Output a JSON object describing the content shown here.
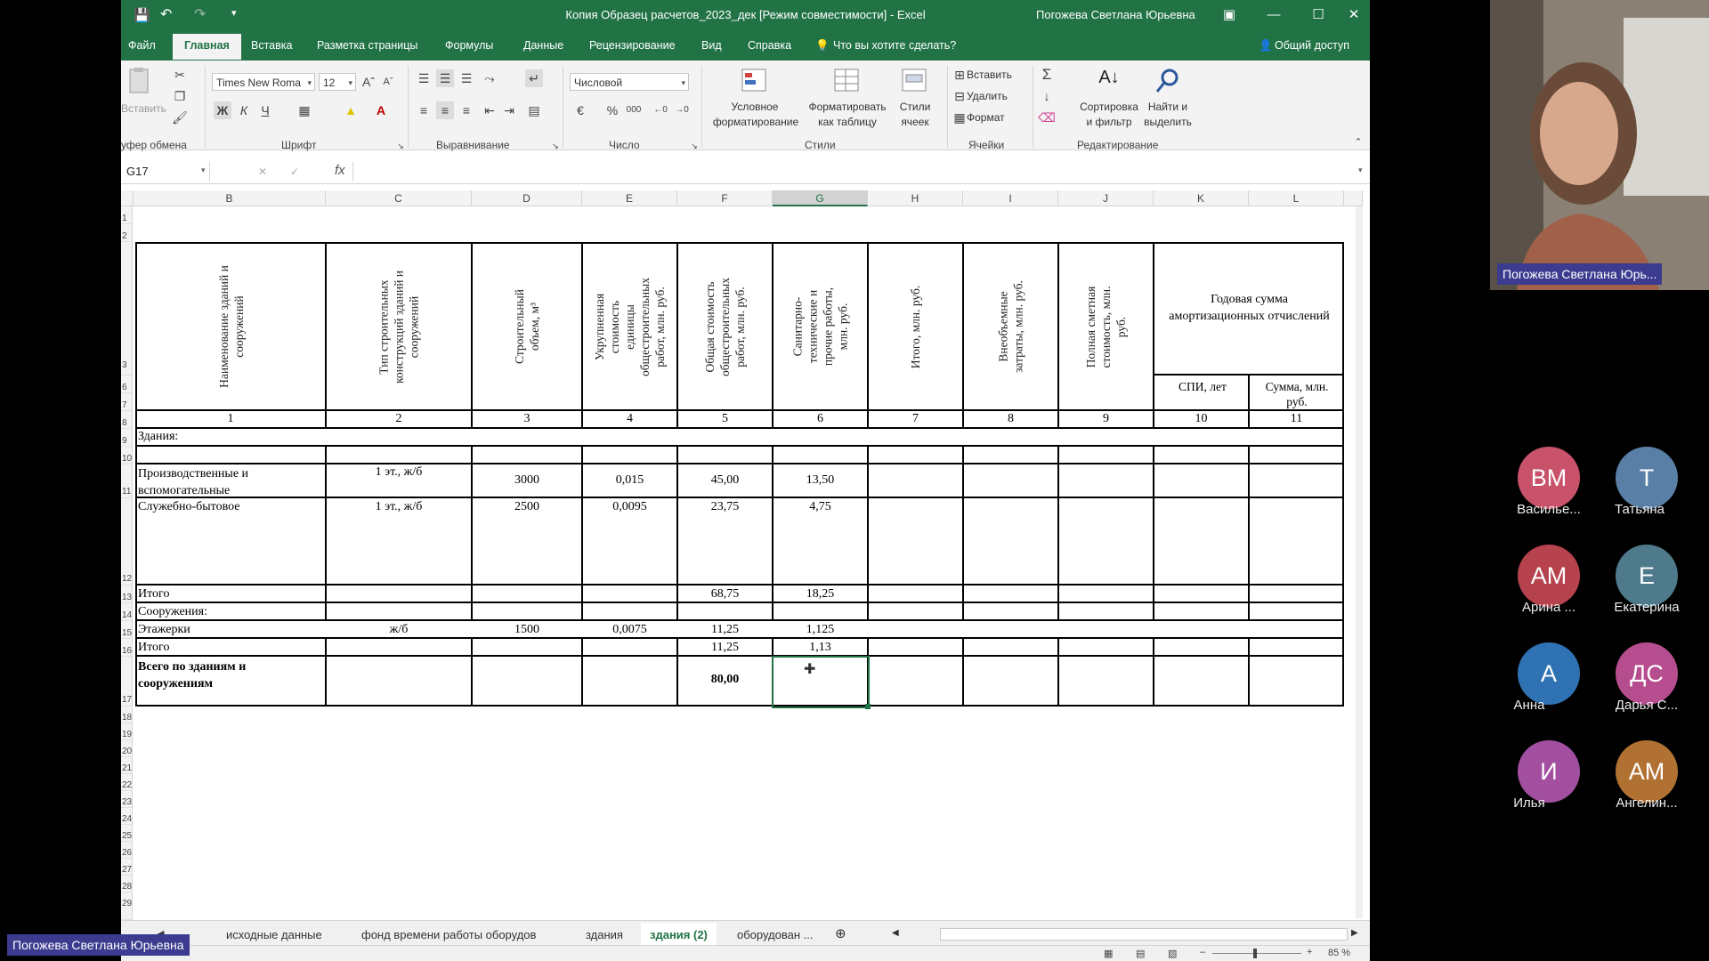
{
  "window": {
    "title": "Копия Образец расчетов_2023_дек  [Режим совместимости]  -  Excel",
    "user": "Погожева Светлана Юрьевна"
  },
  "ribbon_tabs": [
    "Файл",
    "Главная",
    "Вставка",
    "Разметка страницы",
    "Формулы",
    "Данные",
    "Рецензирование",
    "Вид",
    "Справка"
  ],
  "tell_me": "Что вы хотите сделать?",
  "share": "Общий доступ",
  "ribbon": {
    "paste": "Вставить",
    "font_name": "Times New Roma",
    "font_size": "12",
    "bold": "Ж",
    "italic": "К",
    "underline": "Ч",
    "number_format": "Числовой",
    "cond_format": [
      "Условное",
      "форматирование"
    ],
    "format_table": [
      "Форматировать",
      "как таблицу"
    ],
    "cell_styles": [
      "Стили",
      "ячеек"
    ],
    "insert": "Вставить",
    "delete": "Удалить",
    "format": "Формат",
    "sort": [
      "Сортировка",
      "и фильтр"
    ],
    "find": [
      "Найти и",
      "выделить"
    ],
    "groups": {
      "clipboard": "уфер обмена",
      "font": "Шрифт",
      "alignment": "Выравнивание",
      "number": "Число",
      "styles": "Стили",
      "cells": "Ячейки",
      "editing": "Редактирование"
    }
  },
  "namebox": "G17",
  "columns": [
    "B",
    "C",
    "D",
    "E",
    "F",
    "G",
    "H",
    "I",
    "J",
    "K",
    "L"
  ],
  "selected_column": "G",
  "rows": [
    "1",
    "2",
    "3",
    "6",
    "7",
    "8",
    "9",
    "10",
    "11",
    "12",
    "13",
    "14",
    "15",
    "16",
    "17",
    "18",
    "19",
    "20",
    "21",
    "22",
    "23",
    "24",
    "25",
    "26",
    "27",
    "28",
    "29"
  ],
  "table": {
    "headers": [
      "Наименование зданий и сооружений",
      "Тип строительных конструкций зданий и сооружений",
      "Строительный объем, м³",
      "Укрупненная стоимость единицы общестроительных работ, млн. руб.",
      "Общая стоимость общестроительных работ, млн. руб.",
      "Санитарно-технические и прочие работы, млн. руб.",
      "Итого, млн. руб.",
      "Внеобъемные затраты, млн. руб.",
      "Полная сметная стоимость, млн. руб."
    ],
    "amort_header": "Годовая сумма амортизационных отчислений",
    "amort_sub1": "СПИ, лет",
    "amort_sub2": "Сумма, млн. руб.",
    "col_numbers": [
      "1",
      "2",
      "3",
      "4",
      "5",
      "6",
      "7",
      "8",
      "9",
      "10",
      "11"
    ],
    "section_buildings": "Здания:",
    "row11": {
      "name": "Производственные и вспомогательные",
      "type": "1 эт., ж/б",
      "volume": "3000",
      "unit": "0,015",
      "total": "45,00",
      "san": "13,50"
    },
    "row12": {
      "name": "Служебно-бытовое",
      "type": "1 эт., ж/б",
      "volume": "2500",
      "unit": "0,0095",
      "total": "23,75",
      "san": "4,75"
    },
    "row13": {
      "name": "Итого",
      "total": "68,75",
      "san": "18,25"
    },
    "section_structures": "Сооружения:",
    "row15": {
      "name": "Этажерки",
      "type": "ж/б",
      "volume": "1500",
      "unit": "0,0075",
      "total": "11,25",
      "san": "1,125"
    },
    "row16": {
      "name": "Итого",
      "total": "11,25",
      "san": "1,13"
    },
    "row17": {
      "name": "Всего по зданиям и сооружениям",
      "total": "80,00"
    }
  },
  "sheet_tabs": [
    "исходные данные",
    "фонд времени  работы оборудов",
    "здания",
    "здания (2)",
    "оборудован ..."
  ],
  "active_sheet": "здания (2)",
  "zoom": "85 %",
  "participants": {
    "presenter": "Погожева Светлана Юрь...",
    "self": "Погожева Светлана Юрьевна",
    "list": [
      {
        "initials": "ВМ",
        "name": "Василье...",
        "color": "#c8526a"
      },
      {
        "initials": "Т",
        "name": "Татьяна",
        "color": "#5a7fa6"
      },
      {
        "initials": "АМ",
        "name": "Арина ...",
        "color": "#b5424d"
      },
      {
        "initials": "Е",
        "name": "Екатерина",
        "color": "#4e7a8c"
      },
      {
        "initials": "А",
        "name": "Анна",
        "color": "#2f72b3"
      },
      {
        "initials": "ДС",
        "name": "Дарья С...",
        "color": "#b54d8e"
      },
      {
        "initials": "И",
        "name": "Илья",
        "color": "#a24fa0"
      },
      {
        "initials": "АМ",
        "name": "Ангелин...",
        "color": "#b07132"
      }
    ]
  }
}
